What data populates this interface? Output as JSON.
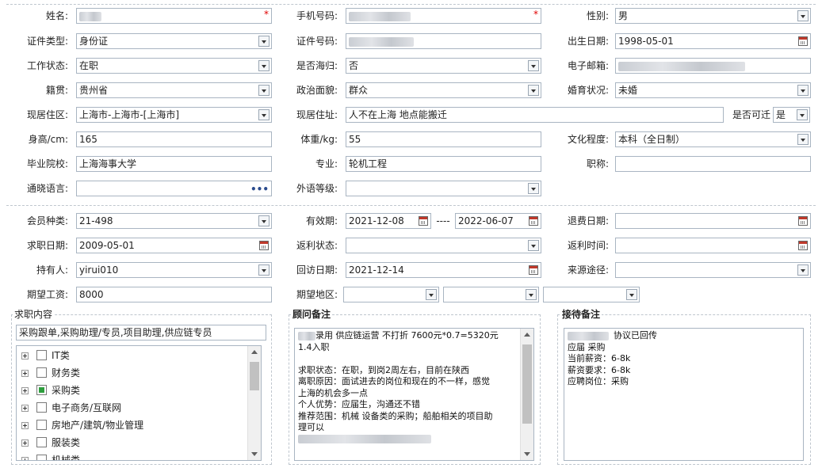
{
  "fields": {
    "name": {
      "label": "姓名:",
      "value": ""
    },
    "phone": {
      "label": "手机号码:",
      "value": ""
    },
    "gender": {
      "label": "性别:",
      "value": "男"
    },
    "id_type": {
      "label": "证件类型:",
      "value": "身份证"
    },
    "id_number": {
      "label": "证件号码:",
      "value": ""
    },
    "birth_date": {
      "label": "出生日期:",
      "value": "1998-05-01"
    },
    "work_status": {
      "label": "工作状态:",
      "value": "在职"
    },
    "returnee": {
      "label": "是否海归:",
      "value": "否"
    },
    "email": {
      "label": "电子邮箱:",
      "value": ""
    },
    "native_place": {
      "label": "籍贯:",
      "value": "贵州省"
    },
    "political": {
      "label": "政治面貌:",
      "value": "群众"
    },
    "marital": {
      "label": "婚育状况:",
      "value": "未婚"
    },
    "residence_area": {
      "label": "现居住区:",
      "value": "上海市-上海市-[上海市]"
    },
    "residence_addr": {
      "label": "现居住址:",
      "value": "人不在上海  地点能搬迁"
    },
    "relocatable": {
      "label": "是否可迁",
      "value": "是"
    },
    "height": {
      "label": "身高/cm:",
      "value": "165"
    },
    "weight": {
      "label": "体重/kg:",
      "value": "55"
    },
    "education": {
      "label": "文化程度:",
      "value": "本科（全日制）"
    },
    "school": {
      "label": "毕业院校:",
      "value": "上海海事大学"
    },
    "major": {
      "label": "专业:",
      "value": "轮机工程"
    },
    "title": {
      "label": "职称:",
      "value": ""
    },
    "languages": {
      "label": "通晓语言:",
      "value": ""
    },
    "foreign_level": {
      "label": "外语等级:",
      "value": ""
    },
    "member_type": {
      "label": "会员种类:",
      "value": "21-498"
    },
    "valid_period": {
      "label": "有效期:",
      "from": "2021-12-08",
      "sep": "----",
      "to": "2022-06-07"
    },
    "refund_date": {
      "label": "退费日期:",
      "value": ""
    },
    "job_date": {
      "label": "求职日期:",
      "value": "2009-05-01"
    },
    "rebate_status": {
      "label": "返利状态:",
      "value": ""
    },
    "rebate_time": {
      "label": "返利时间:",
      "value": ""
    },
    "holder": {
      "label": "持有人:",
      "value": "yirui010"
    },
    "revisit_date": {
      "label": "回访日期:",
      "value": "2021-12-14"
    },
    "source": {
      "label": "来源途径:",
      "value": ""
    },
    "expected_salary": {
      "label": "期望工资:",
      "value": "8000"
    },
    "expected_region": {
      "label": "期望地区:",
      "value": ""
    }
  },
  "job_content": {
    "title": "求职内容",
    "summary": "采购跟单,采购助理/专员,项目助理,供应链专员",
    "tree": [
      {
        "label": "IT类",
        "checked": false
      },
      {
        "label": "财务类",
        "checked": false
      },
      {
        "label": "采购类",
        "checked": true
      },
      {
        "label": "电子商务/互联网",
        "checked": false
      },
      {
        "label": "房地产/建筑/物业管理",
        "checked": false
      },
      {
        "label": "服装类",
        "checked": false
      },
      {
        "label": "机械类",
        "checked": false
      }
    ]
  },
  "advisor_notes": {
    "title": "顾问备注",
    "lines": [
      "录用 供应链运营 不打折 7600元*0.7=5320元",
      "1.4入职",
      "",
      "求职状态：在职，到岗2周左右，目前在陕西",
      "离职原因：面试进去的岗位和现在的不一样，感觉",
      "上海的机会多一点",
      "个人优势：应届生，沟通还不错",
      "推荐范围：机械 设备类的采购；船舶相关的项目助",
      "理可以"
    ]
  },
  "reception_notes": {
    "title": "接待备注",
    "lines": [
      "协议已回传",
      "应届 采购",
      "当前薪资：6-8k",
      "薪资要求：6-8k",
      "应聘岗位：采购"
    ]
  },
  "colors": {
    "border": "#a9b5c2",
    "required": "#e00000",
    "checked": "#2e9e3e"
  }
}
